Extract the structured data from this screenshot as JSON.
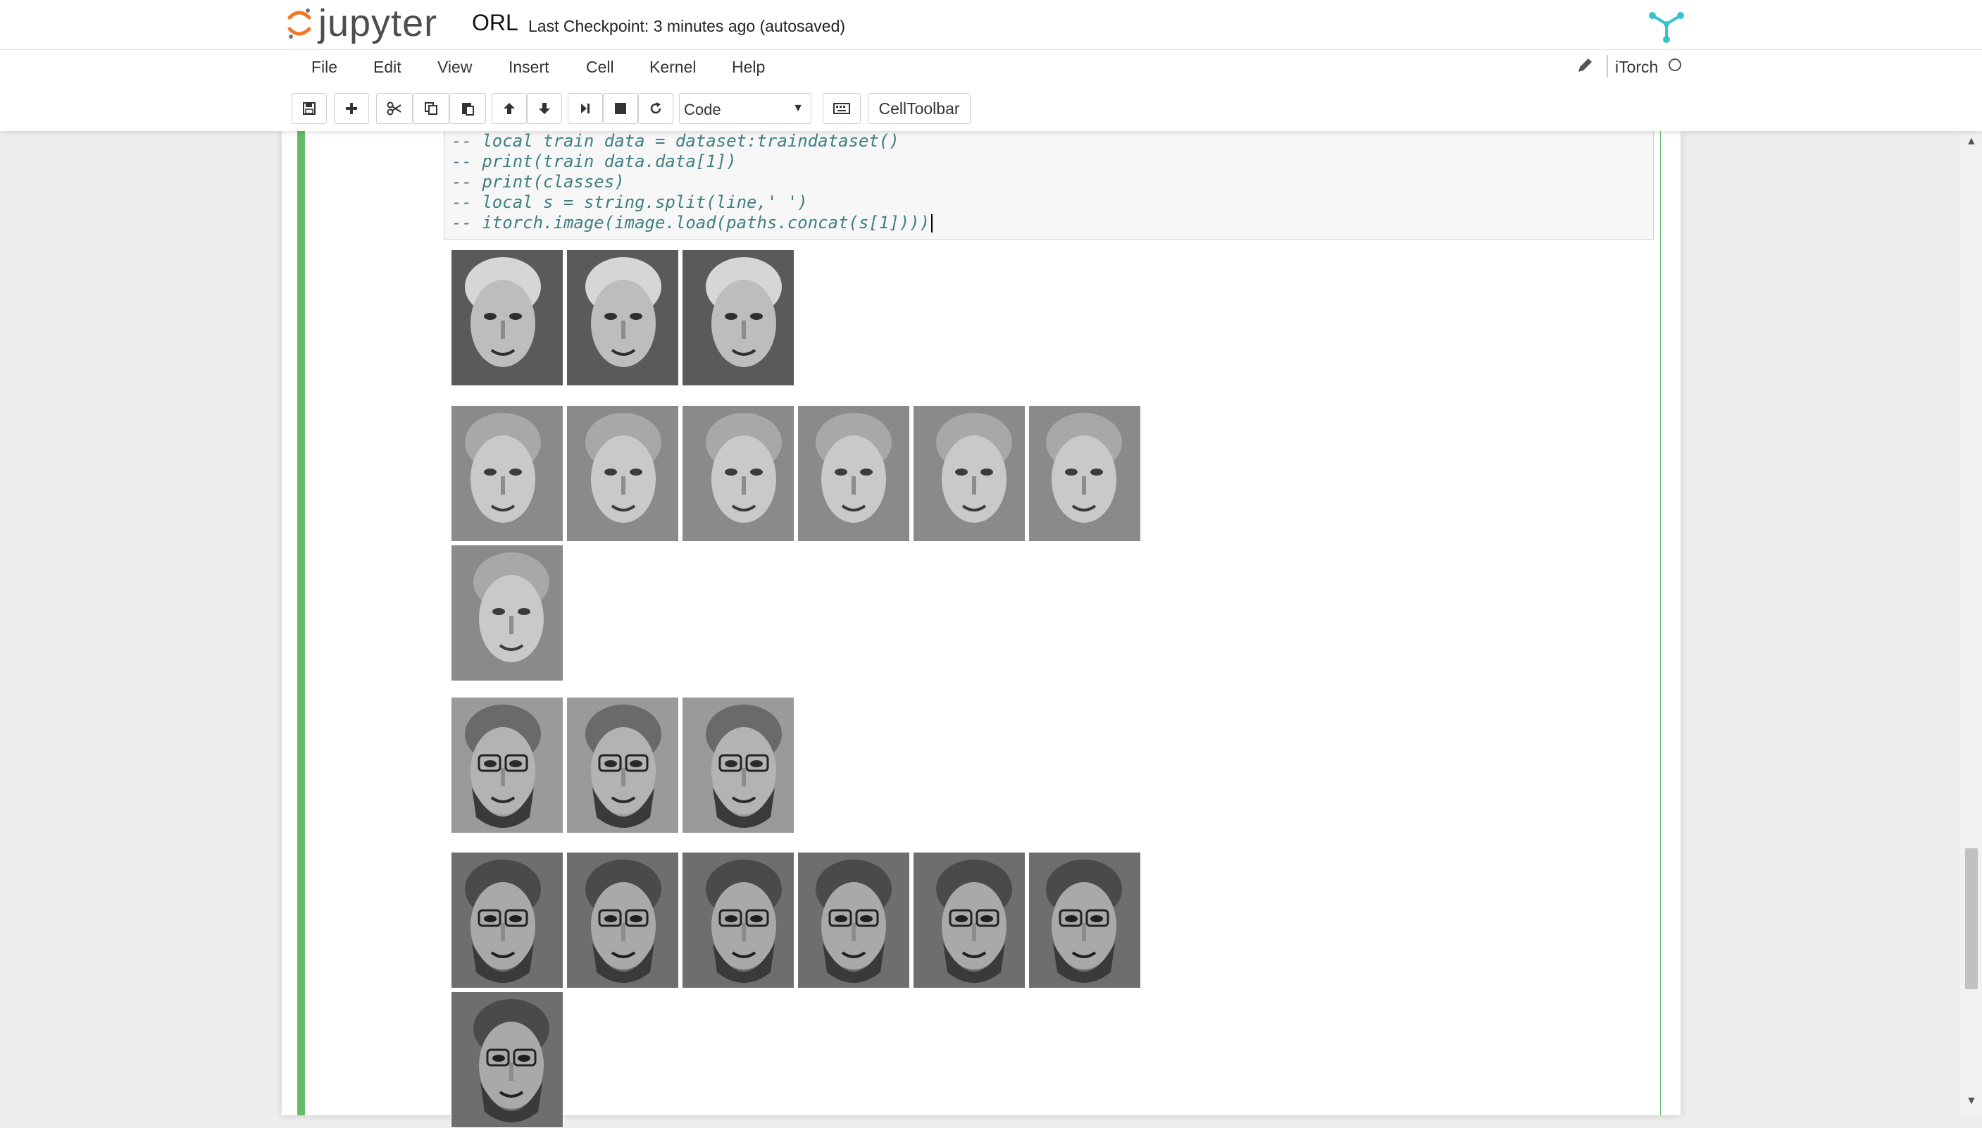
{
  "app": {
    "logo_text": "jupyter",
    "notebook_name": "ORL",
    "checkpoint": "Last Checkpoint: 3 minutes ago (autosaved)",
    "accent_color": "#f37726",
    "kernel_logo_color": "#36c3d0"
  },
  "menu": {
    "items": [
      "File",
      "Edit",
      "View",
      "Insert",
      "Cell",
      "Kernel",
      "Help"
    ]
  },
  "kernel": {
    "name": "iTorch",
    "status": "idle"
  },
  "toolbar": {
    "buttons": [
      "save-icon",
      "add-icon",
      "cut-icon",
      "copy-icon",
      "paste-icon",
      "move-up-icon",
      "move-down-icon",
      "run-icon",
      "stop-icon",
      "restart-icon"
    ],
    "cell_type": "Code",
    "celltoolbar_label": "CellToolbar"
  },
  "cell": {
    "selected_color": "#66bb6a",
    "code_lines": [
      "-- local train data = dataset:traindataset()",
      "-- print(train data.data[1])",
      "-- print(classes)",
      "-- local s = string.split(line,' ')",
      "-- itorch.image(image.load(paths.concat(s[1])))"
    ]
  },
  "output": {
    "groups": [
      {
        "name": "person-woman",
        "count": 3
      },
      {
        "name": "person-young-man",
        "count": 7
      },
      {
        "name": "person-bearded-man-a",
        "count": 3
      },
      {
        "name": "person-bearded-man-b",
        "count": 7
      }
    ]
  }
}
